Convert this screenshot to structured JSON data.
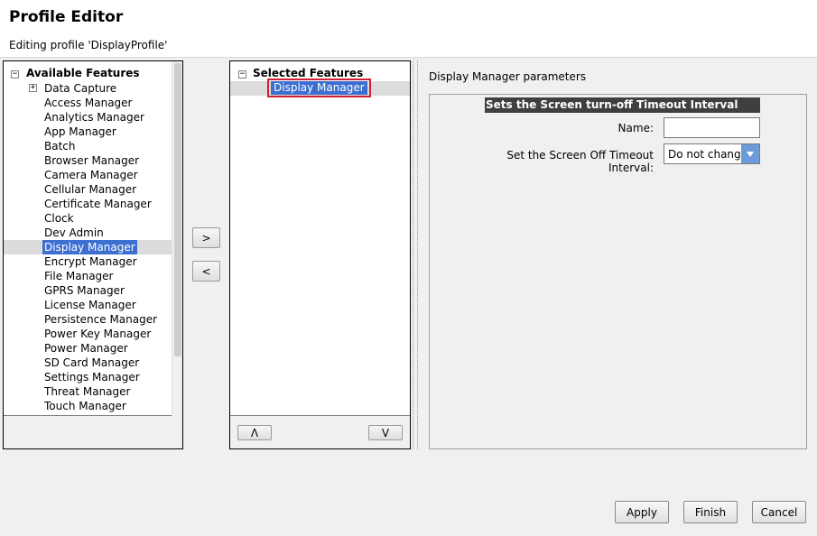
{
  "header": {
    "title": "Profile Editor",
    "subtitle": "Editing profile 'DisplayProfile'"
  },
  "available": {
    "root_label": "Available Features",
    "expander_collapse": "−",
    "expander_expand": "+",
    "items": [
      "Data Capture",
      "Access Manager",
      "Analytics Manager",
      "App Manager",
      "Batch",
      "Browser Manager",
      "Camera Manager",
      "Cellular Manager",
      "Certificate Manager",
      "Clock",
      "Dev Admin",
      "Display Manager",
      "Encrypt Manager",
      "File Manager",
      "GPRS Manager",
      "License Manager",
      "Persistence Manager",
      "Power Key Manager",
      "Power Manager",
      "SD Card Manager",
      "Settings Manager",
      "Threat Manager",
      "Touch Manager"
    ],
    "selected_item": "Display Manager"
  },
  "move": {
    "add_label": ">",
    "remove_label": "<"
  },
  "selected": {
    "root_label": "Selected Features",
    "expander": "−",
    "items": [
      "Display Manager"
    ],
    "up_label": "Λ",
    "down_label": "V"
  },
  "params": {
    "caption": "Display Manager parameters",
    "section_header": "Sets the Screen turn-off Timeout Interval",
    "name_label": "Name:",
    "name_value": "",
    "timeout_label": "Set the Screen Off Timeout Interval:",
    "timeout_value": "Do not change"
  },
  "actions": {
    "apply": "Apply",
    "finish": "Finish",
    "cancel": "Cancel"
  },
  "colors": {
    "selection": "#3c6fd0",
    "highlight_border": "#d2202f",
    "section_header_bg": "#3f3f3f",
    "dropdown_arrow": "#6c9bd9"
  }
}
